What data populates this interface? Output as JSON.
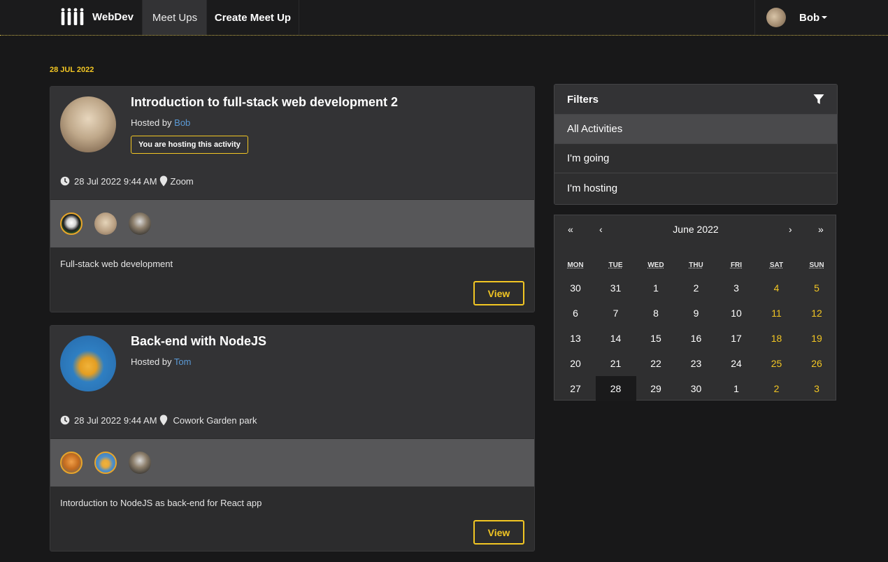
{
  "nav": {
    "brand": "WebDev",
    "items": [
      "Meet Ups",
      "Create Meet Up"
    ],
    "user": "Bob"
  },
  "date_header": "28 JUL 2022",
  "activities": [
    {
      "title": "Introduction to full-stack web development 2",
      "hosted_prefix": "Hosted by ",
      "host": "Bob",
      "badge": "You are hosting this activity",
      "datetime": "28 Jul 2022 9:44 AM",
      "venue": "Zoom",
      "description": "Full-stack web development",
      "view_label": "View"
    },
    {
      "title": "Back-end with NodeJS",
      "hosted_prefix": "Hosted by ",
      "host": "Tom",
      "datetime": "28 Jul 2022 9:44 AM",
      "venue": "Cowork Garden park",
      "description": "Intorduction to NodeJS as back-end for React app",
      "view_label": "View"
    }
  ],
  "filters": {
    "title": "Filters",
    "items": [
      "All Activities",
      "I'm going",
      "I'm hosting"
    ],
    "active": "All Activities"
  },
  "calendar": {
    "month_label": "June 2022",
    "prev_year": "«",
    "prev_month": "‹",
    "next_month": "›",
    "next_year": "»",
    "weekdays": [
      "MON",
      "TUE",
      "WED",
      "THU",
      "FRI",
      "SAT",
      "SUN"
    ],
    "weeks": [
      [
        "30",
        "31",
        "1",
        "2",
        "3",
        "4",
        "5"
      ],
      [
        "6",
        "7",
        "8",
        "9",
        "10",
        "11",
        "12"
      ],
      [
        "13",
        "14",
        "15",
        "16",
        "17",
        "18",
        "19"
      ],
      [
        "20",
        "21",
        "22",
        "23",
        "24",
        "25",
        "26"
      ],
      [
        "27",
        "28",
        "29",
        "30",
        "1",
        "2",
        "3"
      ]
    ],
    "selected": "28",
    "colors": {
      "accent": "#f2c623"
    }
  }
}
